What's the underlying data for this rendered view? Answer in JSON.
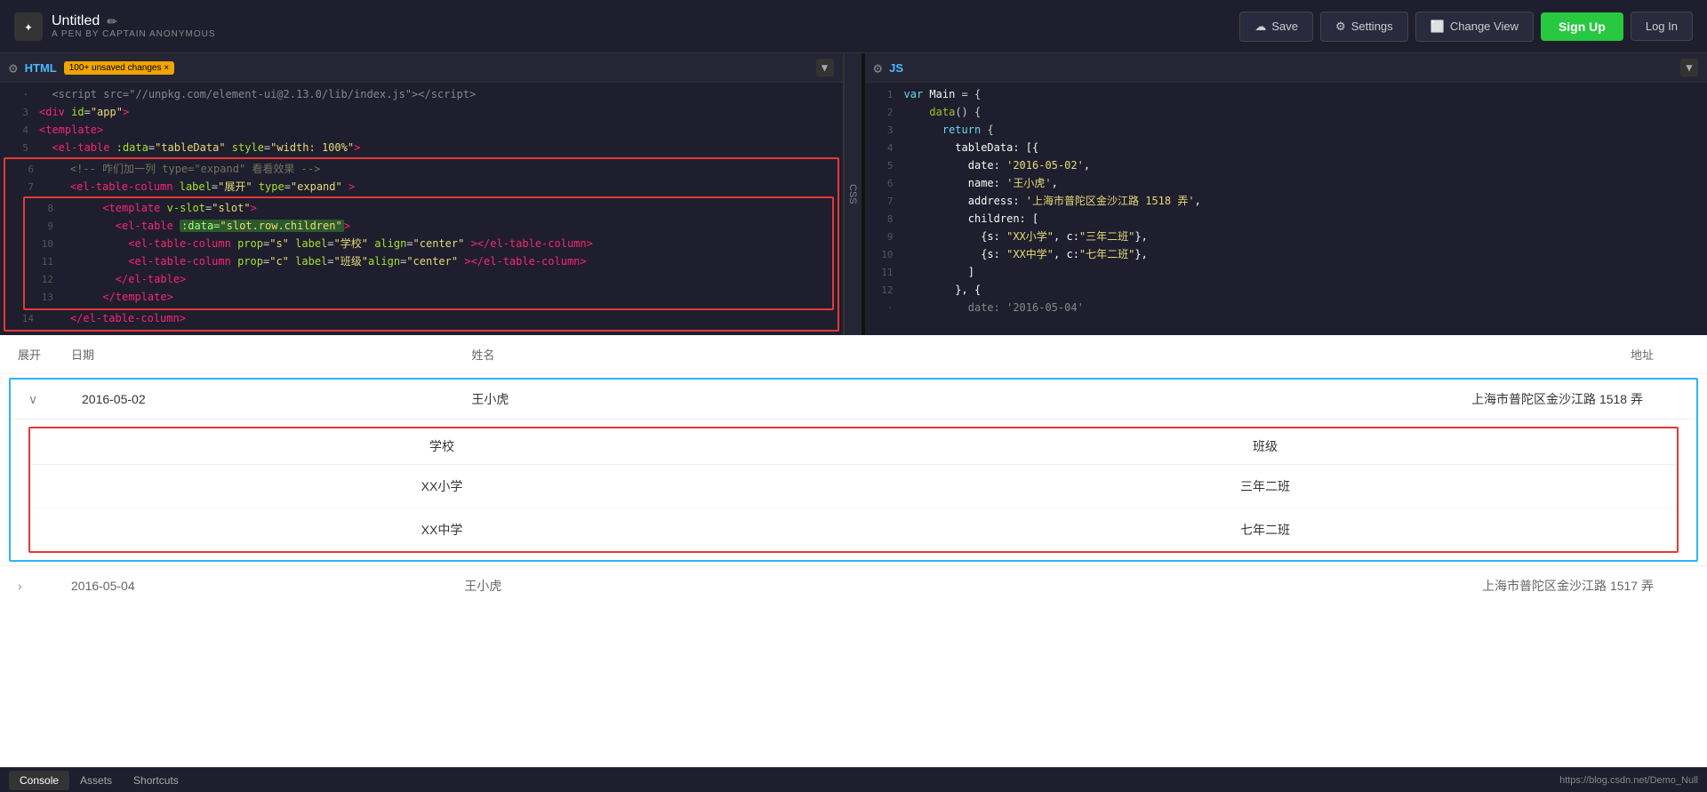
{
  "header": {
    "title": "Untitled",
    "subtitle": "A PEN BY CAPTAIN ANONYMOUS",
    "save_label": "Save",
    "settings_label": "Settings",
    "change_view_label": "Change View",
    "signup_label": "Sign Up",
    "login_label": "Log In"
  },
  "html_panel": {
    "label": "HTML",
    "badge": "100+ unsaved changes ×"
  },
  "css_panel": {
    "label": "CSS"
  },
  "js_panel": {
    "label": "JS"
  },
  "bottom_bar": {
    "console_label": "Console",
    "assets_label": "Assets",
    "shortcuts_label": "Shortcuts",
    "url": "https://blog.csdn.net/Demo_Null"
  },
  "table": {
    "col_expand": "展开",
    "col_date": "日期",
    "col_name": "姓名",
    "col_address": "地址",
    "row1": {
      "date": "2016-05-02",
      "name": "王小虎",
      "address": "上海市普陀区金沙江路 1518 弄"
    },
    "nested": {
      "col_school": "学校",
      "col_class": "班级",
      "rows": [
        {
          "school": "XX小学",
          "class": "三年二班"
        },
        {
          "school": "XX中学",
          "class": "七年二班"
        }
      ]
    },
    "row2": {
      "date": "2016-05-04",
      "name": "王小虎",
      "address": "上海市普陀区金沙江路 1517 弄"
    }
  }
}
